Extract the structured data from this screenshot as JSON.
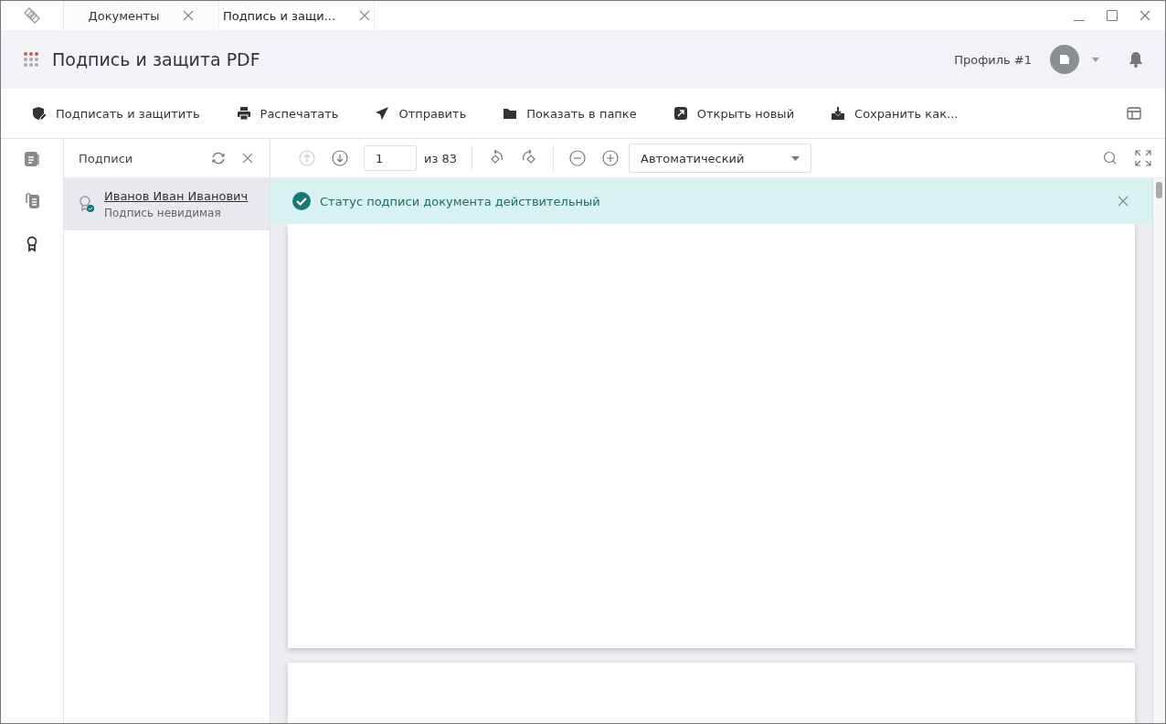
{
  "tabs": [
    {
      "label": "Документы",
      "selected": false
    },
    {
      "label": "Подпись и защи...",
      "selected": true
    }
  ],
  "app": {
    "title": "Подпись и защита PDF",
    "profile": "Профиль #1"
  },
  "toolbar": [
    {
      "kind": "shield",
      "label": "Подписать и защитить"
    },
    {
      "kind": "printer",
      "label": "Распечатать"
    },
    {
      "kind": "send",
      "label": "Отправить"
    },
    {
      "kind": "folder",
      "label": "Показать в папке"
    },
    {
      "kind": "open",
      "label": "Открыть новый"
    },
    {
      "kind": "download",
      "label": "Сохранить как..."
    }
  ],
  "rail": [
    {
      "kind": "document",
      "selected": false
    },
    {
      "kind": "stamp",
      "selected": false
    },
    {
      "kind": "award",
      "selected": true
    }
  ],
  "signatures_panel": {
    "title": "Подписи",
    "items": [
      {
        "name": "Иванов Иван Иванович",
        "note": "Подпись невидимая",
        "selected": true
      }
    ]
  },
  "viewer": {
    "page": "1",
    "page_count": "из 83",
    "zoom": "Автоматический"
  },
  "banner": {
    "message": "Статус подписи документа действительный"
  }
}
